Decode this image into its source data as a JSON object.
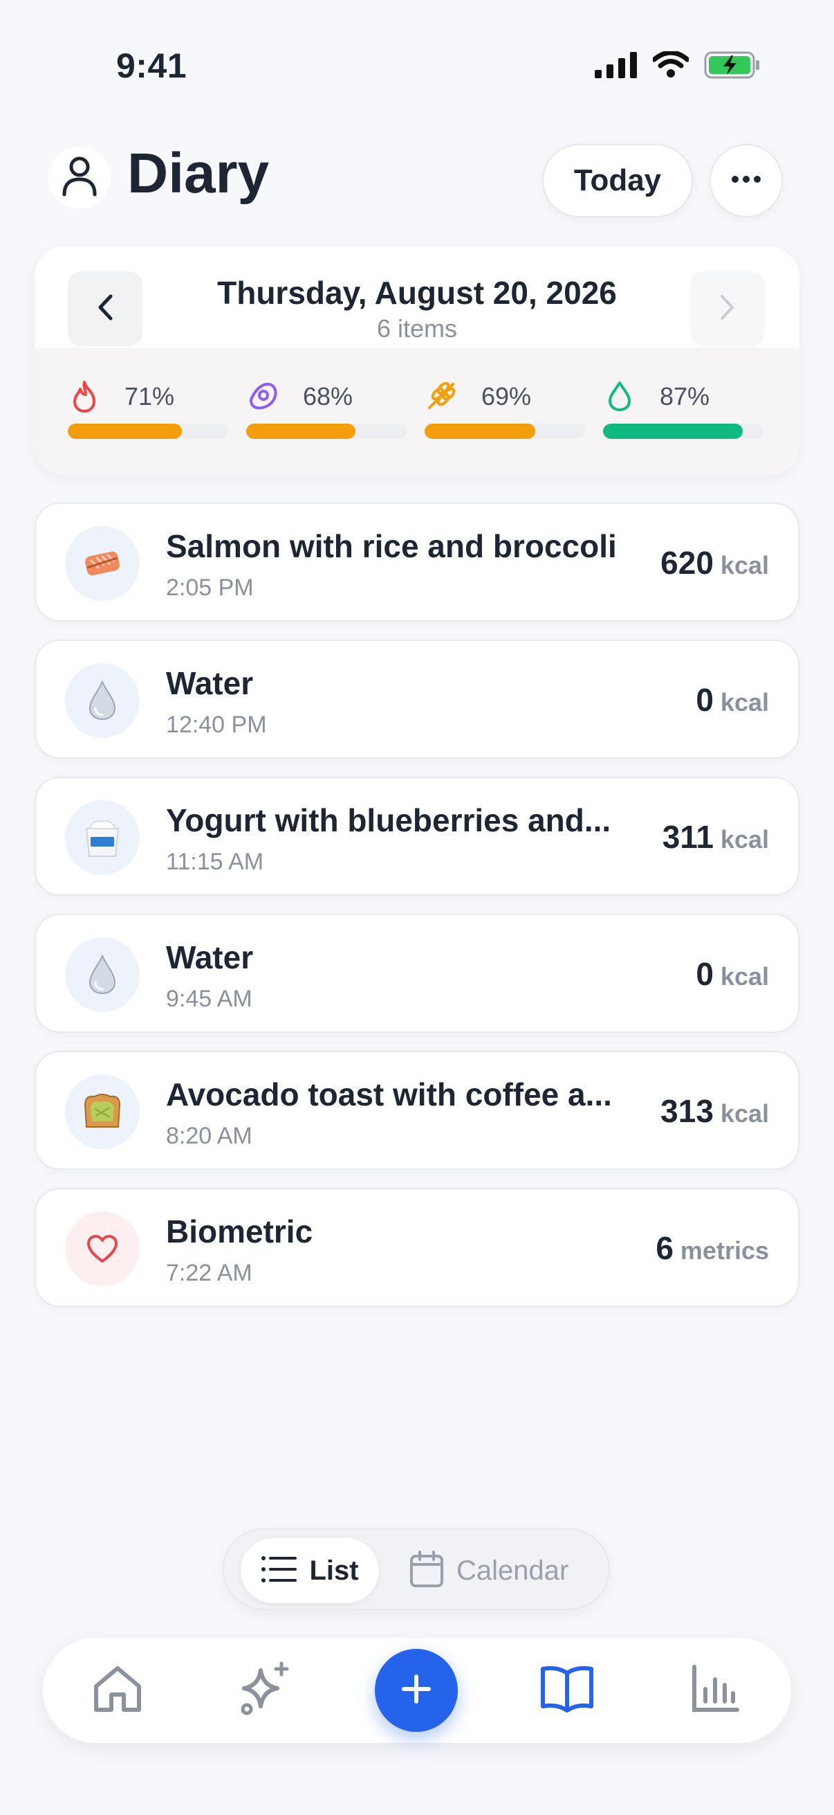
{
  "status_bar": {
    "time": "9:41",
    "icons": [
      "cellular-signal-icon",
      "wifi-icon",
      "battery-charging-icon"
    ]
  },
  "header": {
    "title": "Diary",
    "today_label": "Today",
    "icons": {
      "profile": "person-icon",
      "more": "ellipsis-icon"
    }
  },
  "summary": {
    "date": "Thursday, August 20, 2026",
    "item_count": "6 items",
    "macros": [
      {
        "name": "calories",
        "icon": "flame-icon",
        "percent_label": "71%",
        "progress": 0.71,
        "color": "#f59e0b"
      },
      {
        "name": "protein",
        "icon": "meat-icon",
        "percent_label": "68%",
        "progress": 0.68,
        "color": "#f59e0b"
      },
      {
        "name": "carbs",
        "icon": "wheat-icon",
        "percent_label": "69%",
        "progress": 0.69,
        "color": "#f59e0b"
      },
      {
        "name": "water",
        "icon": "droplet-icon",
        "percent_label": "87%",
        "progress": 0.87,
        "color": "#10b981"
      }
    ]
  },
  "entries": [
    {
      "name": "Salmon with rice and broccoli",
      "time": "2:05 PM",
      "value": "620",
      "unit": "kcal",
      "icon": "salmon-icon"
    },
    {
      "name": "Water",
      "time": "12:40 PM",
      "value": "0",
      "unit": "kcal",
      "icon": "water-drop-icon"
    },
    {
      "name": "Yogurt with blueberries and...",
      "time": "11:15 AM",
      "value": "311",
      "unit": "kcal",
      "icon": "yogurt-icon"
    },
    {
      "name": "Water",
      "time": "9:45 AM",
      "value": "0",
      "unit": "kcal",
      "icon": "water-drop-icon"
    },
    {
      "name": "Avocado toast with coffee a...",
      "time": "8:20 AM",
      "value": "313",
      "unit": "kcal",
      "icon": "avocado-toast-icon"
    },
    {
      "name": "Biometric",
      "time": "7:22 AM",
      "value": "6",
      "unit": "metrics",
      "icon": "heart-icon"
    }
  ],
  "view_toggle": {
    "list_label": "List",
    "calendar_label": "Calendar",
    "selected": "List"
  },
  "tab_bar": {
    "tabs": [
      "home-icon",
      "sparkles-icon",
      "plus-icon",
      "book-icon",
      "bar-chart-icon"
    ],
    "active": "book-icon",
    "accent": "#2563eb"
  }
}
